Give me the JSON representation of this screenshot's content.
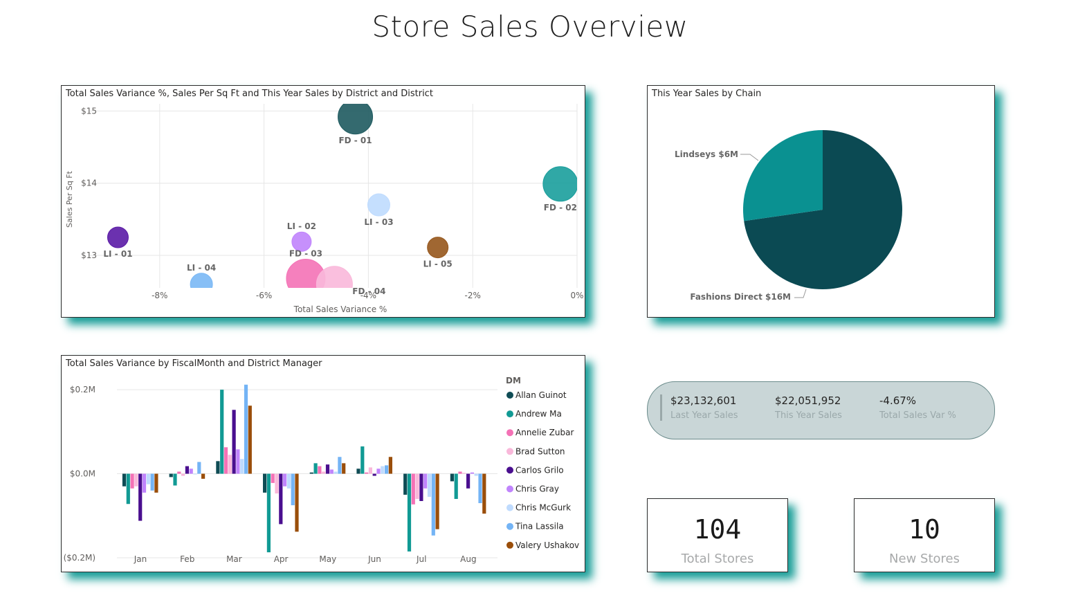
{
  "page": {
    "title": "Store Sales Overview"
  },
  "scatter": {
    "title": "Total Sales Variance %, Sales Per Sq Ft and This Year Sales by District and District",
    "xlabel": "Total Sales Variance %",
    "ylabel": "Sales Per Sq Ft",
    "x_ticks": [
      "-8%",
      "-6%",
      "-4%",
      "-2%",
      "0%"
    ],
    "y_ticks": [
      "$15",
      "$14",
      "$13"
    ]
  },
  "pie": {
    "title": "This Year Sales by Chain",
    "label_lindseys": "Lindseys $6M",
    "label_fashions": "Fashions Direct $16M"
  },
  "bars": {
    "title": "Total Sales Variance by FiscalMonth and District Manager",
    "legend_title": "DM",
    "y_ticks": [
      "$0.2M",
      "$0.0M",
      "($0.2M)"
    ]
  },
  "kpi": {
    "last_year_value": "$23,132,601",
    "last_year_label": "Last Year Sales",
    "this_year_value": "$22,051,952",
    "this_year_label": "This Year Sales",
    "var_value": "-4.67%",
    "var_label": "Total Sales Var %"
  },
  "cards": {
    "total_stores_value": "104",
    "total_stores_label": "Total Stores",
    "new_stores_value": "10",
    "new_stores_label": "New Stores"
  },
  "chart_data": [
    {
      "type": "scatter",
      "title": "Total Sales Variance %, Sales Per Sq Ft and This Year Sales by District and District",
      "xlabel": "Total Sales Variance %",
      "ylabel": "Sales Per Sq Ft",
      "xlim": [
        -0.0935,
        0.0
      ],
      "ylim": [
        12.55,
        15.1
      ],
      "grid": true,
      "points": [
        {
          "label": "FD - 01",
          "x": -0.0425,
          "y": 14.92,
          "size": 25,
          "color": "#1e5a5f"
        },
        {
          "label": "FD - 02",
          "x": -0.0032,
          "y": 13.99,
          "size": 25,
          "color": "#1a9e9c"
        },
        {
          "label": "FD - 03",
          "x": -0.052,
          "y": 12.68,
          "size": 28,
          "color": "#f472b6"
        },
        {
          "label": "FD - 04",
          "x": -0.0465,
          "y": 12.6,
          "size": 26,
          "color": "#f9b8da"
        },
        {
          "label": "LI - 01",
          "x": -0.088,
          "y": 13.25,
          "size": 15,
          "color": "#5b1ba6"
        },
        {
          "label": "LI - 02",
          "x": -0.0528,
          "y": 13.19,
          "size": 14,
          "color": "#c084fc"
        },
        {
          "label": "LI - 03",
          "x": -0.038,
          "y": 13.7,
          "size": 16,
          "color": "#bfdbfe"
        },
        {
          "label": "LI - 04",
          "x": -0.072,
          "y": 12.6,
          "size": 16,
          "color": "#7ab8f5"
        },
        {
          "label": "LI - 05",
          "x": -0.0267,
          "y": 13.11,
          "size": 15,
          "color": "#96561c"
        }
      ]
    },
    {
      "type": "pie",
      "title": "This Year Sales by Chain",
      "slices": [
        {
          "label": "Fashions Direct",
          "value": 16,
          "display": "Fashions Direct $16M",
          "color": "#0b4a53"
        },
        {
          "label": "Lindseys",
          "value": 6,
          "display": "Lindseys $6M",
          "color": "#0a9191"
        }
      ]
    },
    {
      "type": "bar",
      "title": "Total Sales Variance by FiscalMonth and District Manager",
      "categories": [
        "Jan",
        "Feb",
        "Mar",
        "Apr",
        "May",
        "Jun",
        "Jul",
        "Aug"
      ],
      "ylim": [
        -0.205,
        0.215
      ],
      "y_unit": "$M",
      "legend_title": "DM",
      "legend_position": "right",
      "series": [
        {
          "name": "Allan Guinot",
          "color": "#0f4c55",
          "values": [
            -0.03,
            -0.008,
            0.03,
            -0.045,
            0.003,
            0.012,
            -0.05,
            -0.018
          ]
        },
        {
          "name": "Andrew Ma",
          "color": "#119a94",
          "values": [
            -0.072,
            -0.028,
            0.2,
            -0.187,
            0.025,
            0.065,
            -0.185,
            -0.06
          ]
        },
        {
          "name": "Annelie Zubar",
          "color": "#f472b6",
          "values": [
            -0.035,
            0.005,
            0.063,
            -0.022,
            0.018,
            0.003,
            -0.073,
            0.005
          ]
        },
        {
          "name": "Brad Sutton",
          "color": "#f9b8da",
          "values": [
            -0.03,
            -0.005,
            0.045,
            -0.047,
            0.005,
            0.015,
            -0.06,
            0.002
          ]
        },
        {
          "name": "Carlos Grilo",
          "color": "#4a0f8f",
          "values": [
            -0.112,
            0.018,
            0.152,
            -0.12,
            0.022,
            -0.005,
            -0.065,
            -0.035
          ]
        },
        {
          "name": "Chris Gray",
          "color": "#c084fc",
          "values": [
            -0.045,
            0.012,
            0.058,
            -0.03,
            0.01,
            0.012,
            -0.035,
            0.003
          ]
        },
        {
          "name": "Chris McGurk",
          "color": "#bfdbfe",
          "values": [
            -0.025,
            0.0,
            0.035,
            -0.035,
            0.005,
            0.018,
            -0.055,
            -0.005
          ]
        },
        {
          "name": "Tina Lassila",
          "color": "#74b4f5",
          "values": [
            -0.04,
            0.028,
            0.212,
            -0.075,
            0.04,
            0.02,
            -0.147,
            -0.07
          ]
        },
        {
          "name": "Valery Ushakov",
          "color": "#9a4e0a",
          "values": [
            -0.045,
            -0.012,
            0.162,
            -0.138,
            0.025,
            0.04,
            -0.132,
            -0.095
          ]
        }
      ]
    }
  ]
}
